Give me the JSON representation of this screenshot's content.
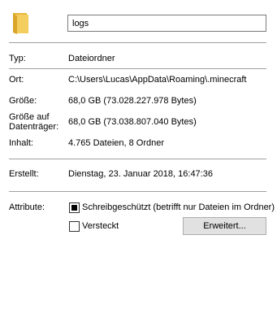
{
  "header": {
    "icon": "folder-icon",
    "name_value": "logs"
  },
  "properties": {
    "type_label": "Typ:",
    "type_value": "Dateiordner",
    "location_label": "Ort:",
    "location_value": "C:\\Users\\Lucas\\AppData\\Roaming\\.minecraft",
    "size_label": "Größe:",
    "size_value": "68,0 GB (73.028.227.978 Bytes)",
    "size_on_disk_label_line1": "Größe auf",
    "size_on_disk_label_line2": "Datenträger:",
    "size_on_disk_value": "68,0 GB (73.038.807.040 Bytes)",
    "contents_label": "Inhalt:",
    "contents_value": "4.765 Dateien, 8 Ordner"
  },
  "dates": {
    "created_label": "Erstellt:",
    "created_value": "Dienstag, 23. Januar 2018, 16:47:36"
  },
  "attributes": {
    "label": "Attribute:",
    "readonly_label": "Schreibgeschützt (betrifft nur Dateien im Ordner)",
    "readonly_state": "indeterminate",
    "hidden_label": "Versteckt",
    "hidden_checked": false,
    "advanced_button": "Erweitert..."
  },
  "colors": {
    "folder": "#f0c24f",
    "separator": "#a0a0a0",
    "button_bg": "#e1e1e1"
  }
}
